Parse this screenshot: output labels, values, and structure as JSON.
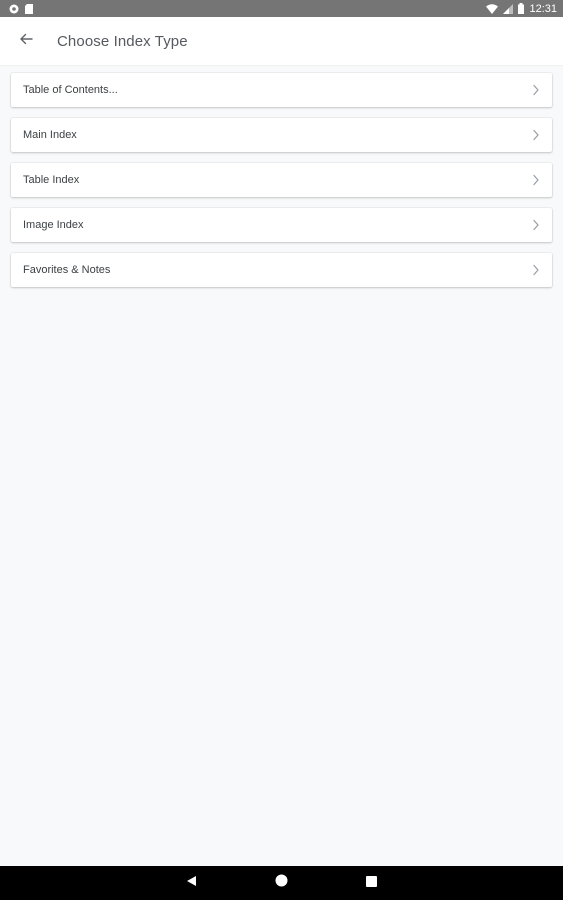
{
  "status_bar": {
    "time": "12:31",
    "left_icons": [
      "settings-notification-icon",
      "sd-card-icon"
    ],
    "right_icons": [
      "wifi-icon",
      "cell-signal-icon",
      "battery-icon"
    ]
  },
  "app_bar": {
    "back_icon": "arrow-back-icon",
    "title": "Choose Index Type"
  },
  "index_types": [
    {
      "label": "Table of Contents..."
    },
    {
      "label": "Main Index"
    },
    {
      "label": "Table Index"
    },
    {
      "label": "Image Index"
    },
    {
      "label": "Favorites & Notes"
    }
  ],
  "nav_bar": {
    "buttons": [
      "back-triangle-icon",
      "home-circle-icon",
      "recents-square-icon"
    ]
  },
  "colors": {
    "status_bar": "#757575",
    "app_bar": "#ffffff",
    "background": "#f8f9fa",
    "nav_bar": "#000000"
  }
}
